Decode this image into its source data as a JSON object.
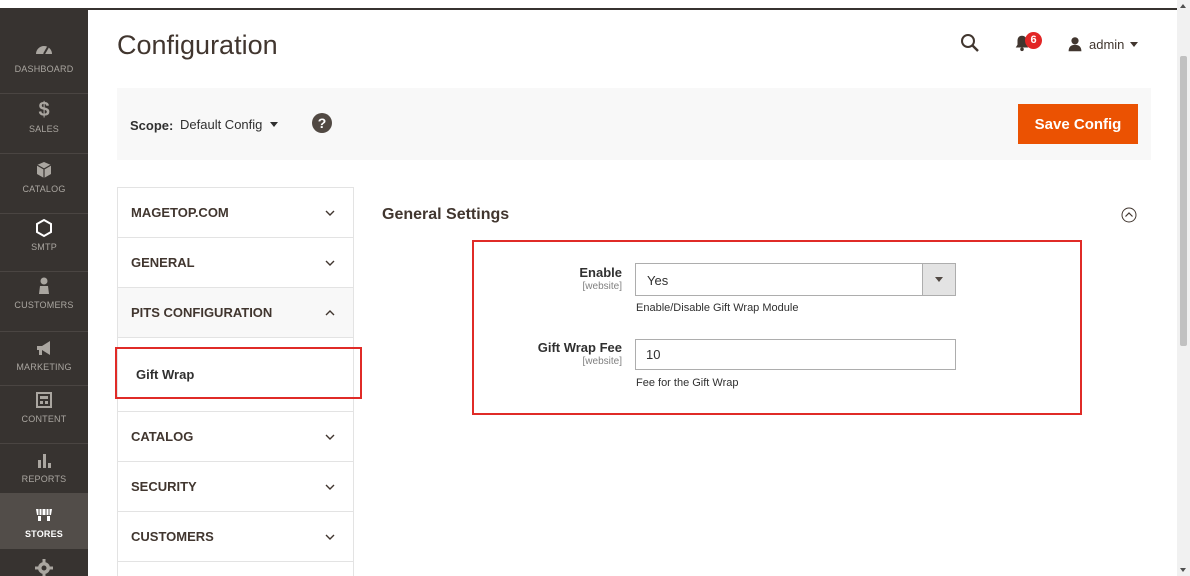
{
  "header": {
    "title": "Configuration",
    "notifications_count": "6",
    "username": "admin"
  },
  "sidebar": {
    "items": [
      {
        "label": "DASHBOARD",
        "icon": "dashboard-icon"
      },
      {
        "label": "SALES",
        "icon": "dollar-icon"
      },
      {
        "label": "CATALOG",
        "icon": "box-icon"
      },
      {
        "label": "SMTP",
        "icon": "hexagon-icon"
      },
      {
        "label": "CUSTOMERS",
        "icon": "person-icon"
      },
      {
        "label": "MARKETING",
        "icon": "megaphone-icon"
      },
      {
        "label": "CONTENT",
        "icon": "layout-icon"
      },
      {
        "label": "REPORTS",
        "icon": "bar-chart-icon"
      },
      {
        "label": "STORES",
        "icon": "store-icon",
        "active": true
      },
      {
        "label": "",
        "icon": "gear-icon"
      }
    ]
  },
  "scope": {
    "label": "Scope:",
    "value": "Default Config",
    "help": "?"
  },
  "save_label": "Save Config",
  "tabs": {
    "items": [
      {
        "label": "MAGETOP.COM"
      },
      {
        "label": "GENERAL"
      },
      {
        "label": "PITS CONFIGURATION",
        "open": true
      },
      {
        "label": "CATALOG"
      },
      {
        "label": "SECURITY"
      },
      {
        "label": "CUSTOMERS"
      }
    ],
    "subitem": "Gift Wrap"
  },
  "section": {
    "title": "General Settings",
    "fields": {
      "enable": {
        "label": "Enable",
        "scope": "[website]",
        "value": "Yes",
        "note": "Enable/Disable Gift Wrap Module"
      },
      "fee": {
        "label": "Gift Wrap Fee",
        "scope": "[website]",
        "value": "10",
        "note": "Fee for the Gift Wrap"
      }
    }
  },
  "colors": {
    "sidebar_bg": "#373330",
    "accent": "#eb5202",
    "highlight": "#e02b27"
  }
}
